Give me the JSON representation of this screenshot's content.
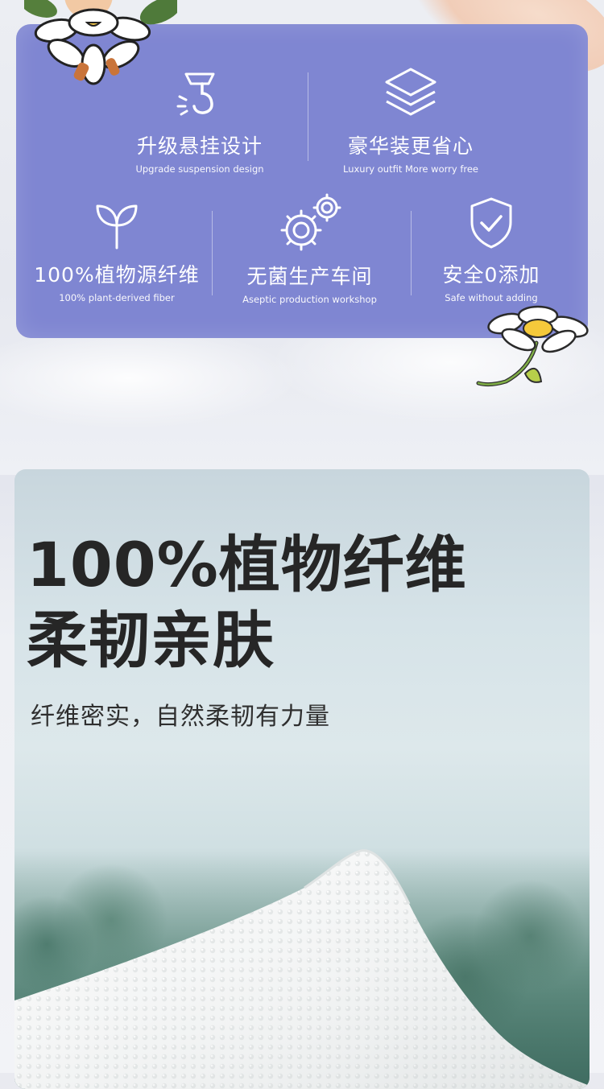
{
  "features": [
    {
      "title": "升级悬挂设计",
      "subtitle": "Upgrade suspension design",
      "icon": "hook-icon"
    },
    {
      "title": "豪华装更省心",
      "subtitle": "Luxury outfit More worry free",
      "icon": "layers-icon"
    },
    {
      "title": "100%植物源纤维",
      "subtitle": "100% plant-derived fiber",
      "icon": "sprout-icon"
    },
    {
      "title": "无菌生产车间",
      "subtitle": "Aseptic production workshop",
      "icon": "gears-icon"
    },
    {
      "title": "安全0添加",
      "subtitle": "Safe without adding",
      "icon": "shield-check-icon"
    }
  ],
  "hero": {
    "headline_line1": "100%植物纤维",
    "headline_line2": "柔韧亲肤",
    "subline": "纤维密实，自然柔韧有力量"
  },
  "colors": {
    "panel": "#7f86d2",
    "text_dark": "#262626"
  }
}
